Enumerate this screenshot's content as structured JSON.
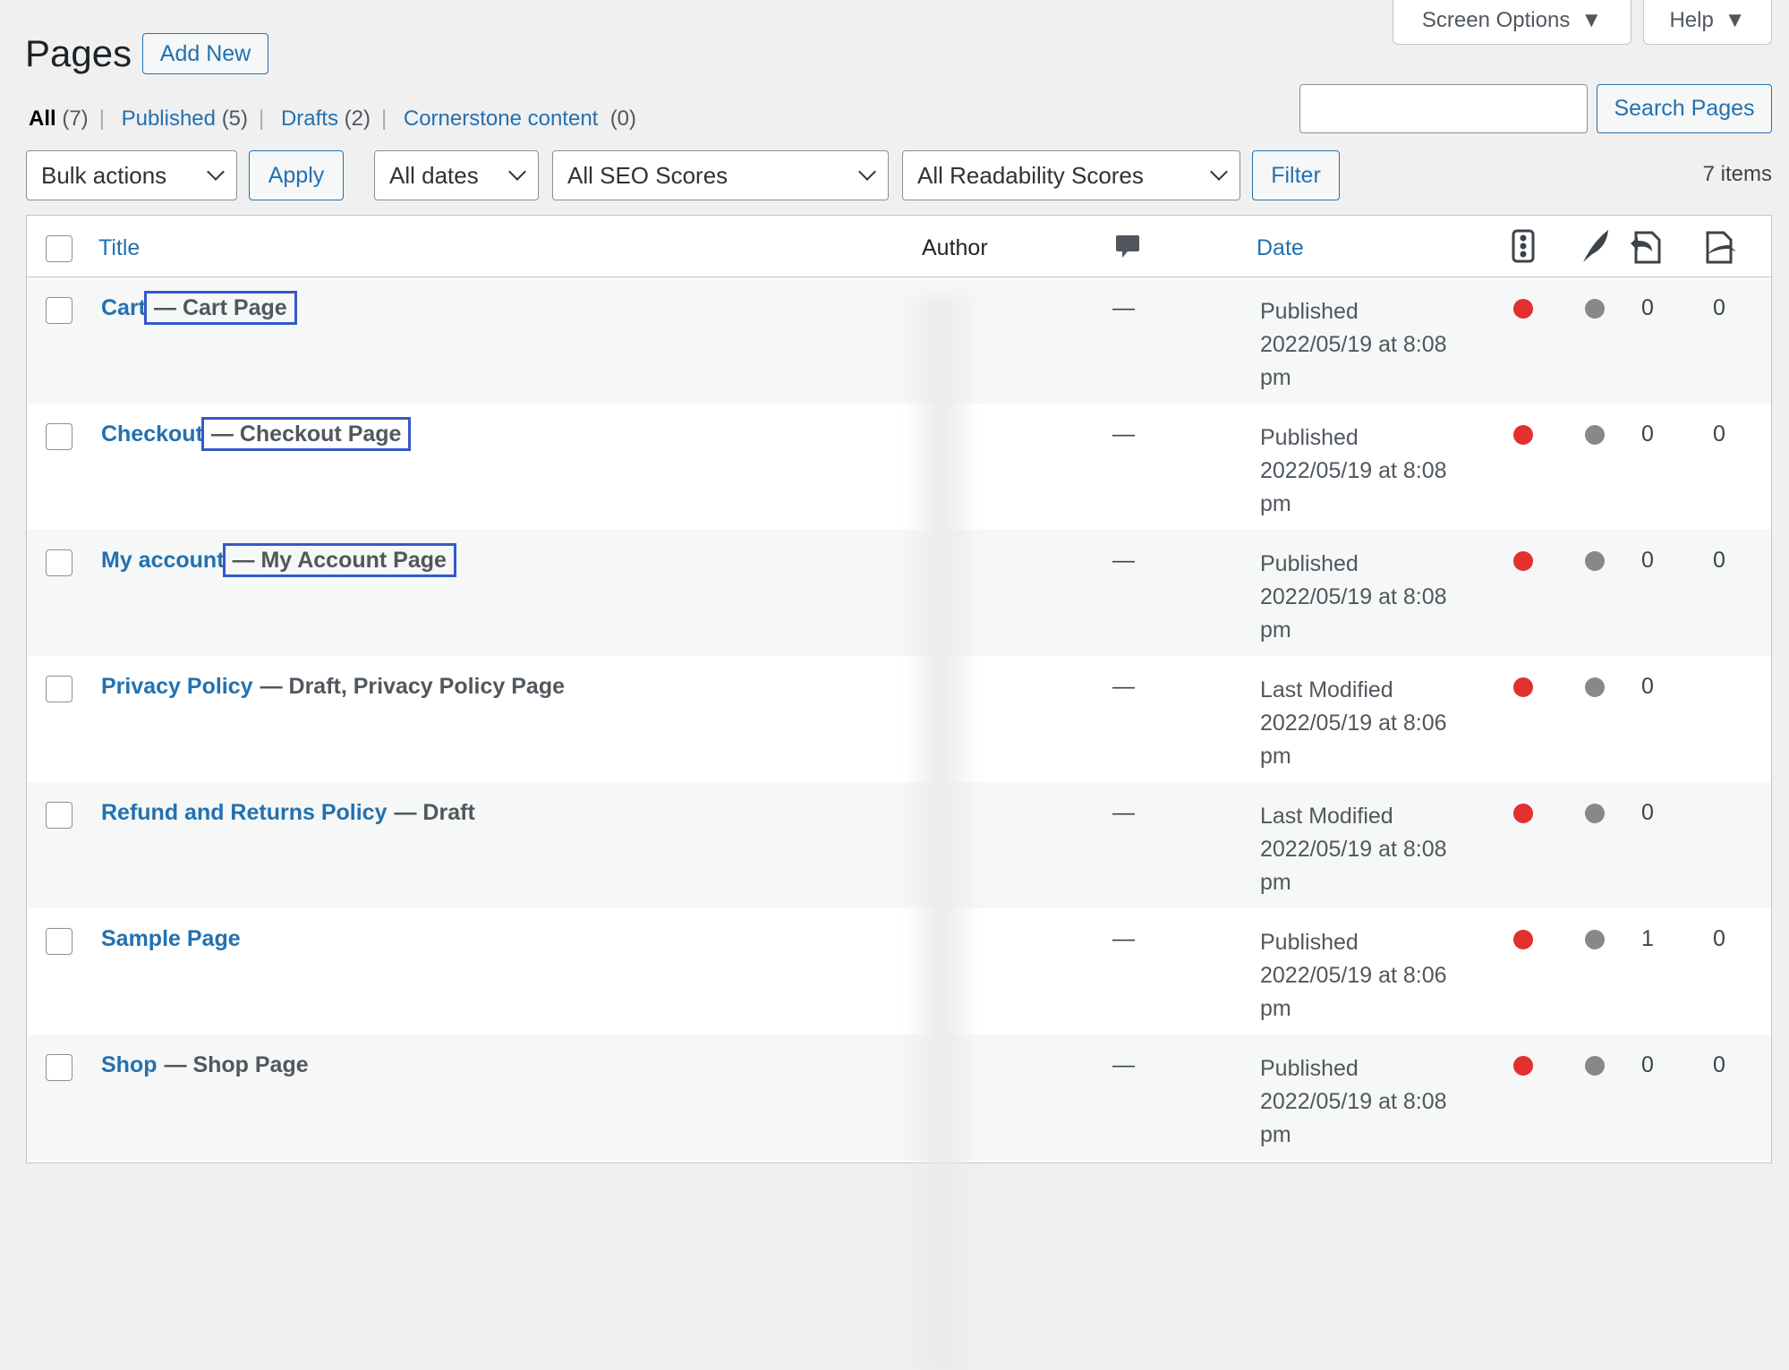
{
  "header": {
    "title": "Pages",
    "add_new": "Add New",
    "screen_options": "Screen Options",
    "help": "Help"
  },
  "status_links": [
    {
      "label": "All",
      "count": "(7)"
    },
    {
      "label": "Published",
      "count": "(5)"
    },
    {
      "label": "Drafts",
      "count": "(2)"
    },
    {
      "label": "Cornerstone content",
      "count": "(0)"
    }
  ],
  "search": {
    "value": "",
    "button": "Search Pages"
  },
  "filters": {
    "bulk": "Bulk actions",
    "apply": "Apply",
    "dates": "All dates",
    "seo": "All SEO Scores",
    "readability": "All Readability Scores",
    "filter": "Filter",
    "items": "7 items"
  },
  "columns": {
    "title": "Title",
    "author": "Author",
    "date": "Date"
  },
  "colors": {
    "seo_bad": "#e2302f",
    "readability_na": "#888888",
    "link": "#2271b1",
    "highlight": "#3558c8"
  },
  "rows": [
    {
      "title": "Cart",
      "state": "— Cart Page",
      "comments": "—",
      "status": "Published",
      "date": "2022/05/19 at 8:08",
      "ampm": "pm",
      "links_in": "0",
      "links_out": "0",
      "highlight": true
    },
    {
      "title": "Checkout",
      "state": "— Checkout Page",
      "comments": "—",
      "status": "Published",
      "date": "2022/05/19 at 8:08",
      "ampm": "pm",
      "links_in": "0",
      "links_out": "0",
      "highlight": true
    },
    {
      "title": "My account",
      "state": "— My Account Page",
      "comments": "—",
      "status": "Published",
      "date": "2022/05/19 at 8:08",
      "ampm": "pm",
      "links_in": "0",
      "links_out": "0",
      "highlight": true
    },
    {
      "title": "Privacy Policy",
      "state": "— Draft, Privacy Policy Page",
      "comments": "—",
      "status": "Last Modified",
      "date": "2022/05/19 at 8:06",
      "ampm": "pm",
      "links_in": "0",
      "links_out": "",
      "highlight": false
    },
    {
      "title": "Refund and Returns Policy",
      "state": "— Draft",
      "comments": "—",
      "status": "Last Modified",
      "date": "2022/05/19 at 8:08",
      "ampm": "pm",
      "links_in": "0",
      "links_out": "",
      "highlight": false
    },
    {
      "title": "Sample Page",
      "state": "",
      "comments": "—",
      "status": "Published",
      "date": "2022/05/19 at 8:06",
      "ampm": "pm",
      "links_in": "1",
      "links_out": "0",
      "highlight": false
    },
    {
      "title": "Shop",
      "state": "— Shop Page",
      "comments": "—",
      "status": "Published",
      "date": "2022/05/19 at 8:08",
      "ampm": "pm",
      "links_in": "0",
      "links_out": "0",
      "highlight": false
    }
  ]
}
